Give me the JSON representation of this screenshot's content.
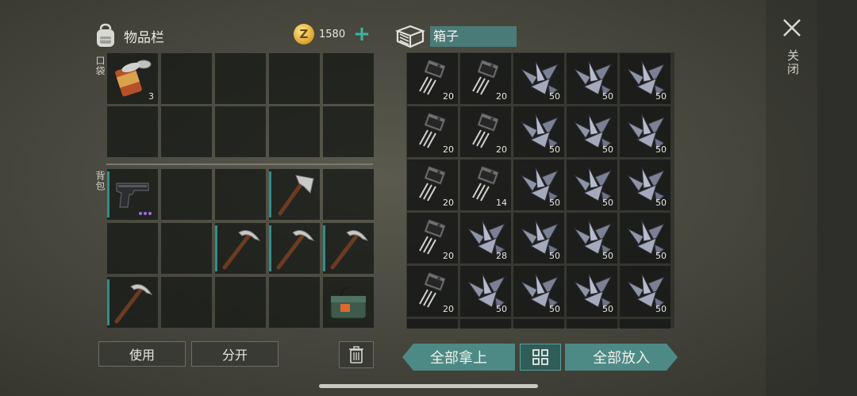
{
  "inventory": {
    "title": "物品栏",
    "coins": "1580",
    "coin_symbol": "Z",
    "add_label": "+",
    "pocket_label": "口袋",
    "backpack_label": "背包",
    "slots": [
      {
        "item": "can-icon",
        "count": "3"
      },
      {
        "item": "pistol-icon",
        "count": "",
        "rarity_dots": 3
      },
      {
        "item": "hatchet-icon",
        "count": ""
      },
      {
        "item": "pickaxe-icon",
        "count": ""
      },
      {
        "item": "pickaxe-icon",
        "count": ""
      },
      {
        "item": "pickaxe-icon",
        "count": ""
      },
      {
        "item": "pickaxe-icon",
        "count": ""
      },
      {
        "item": "ammo-box-icon",
        "count": ""
      }
    ]
  },
  "container": {
    "name": "箱子",
    "rows": [
      [
        {
          "item": "transistor-icon",
          "count": "20"
        },
        {
          "item": "transistor-icon",
          "count": "20"
        },
        {
          "item": "metal-scrap-icon",
          "count": "50"
        },
        {
          "item": "metal-scrap-icon",
          "count": "50"
        },
        {
          "item": "metal-scrap-icon",
          "count": "50"
        }
      ],
      [
        {
          "item": "transistor-icon",
          "count": "20"
        },
        {
          "item": "transistor-icon",
          "count": "20"
        },
        {
          "item": "metal-scrap-icon",
          "count": "50"
        },
        {
          "item": "metal-scrap-icon",
          "count": "50"
        },
        {
          "item": "metal-scrap-icon",
          "count": "50"
        }
      ],
      [
        {
          "item": "transistor-icon",
          "count": "20"
        },
        {
          "item": "transistor-icon",
          "count": "14"
        },
        {
          "item": "metal-scrap-icon",
          "count": "50"
        },
        {
          "item": "metal-scrap-icon",
          "count": "50"
        },
        {
          "item": "metal-scrap-icon",
          "count": "50"
        }
      ],
      [
        {
          "item": "transistor-icon",
          "count": "20"
        },
        {
          "item": "metal-scrap-icon",
          "count": "28"
        },
        {
          "item": "metal-scrap-icon",
          "count": "50"
        },
        {
          "item": "metal-scrap-icon",
          "count": "50"
        },
        {
          "item": "metal-scrap-icon",
          "count": "50"
        }
      ],
      [
        {
          "item": "transistor-icon",
          "count": "20"
        },
        {
          "item": "metal-scrap-icon",
          "count": "50"
        },
        {
          "item": "metal-scrap-icon",
          "count": "50"
        },
        {
          "item": "metal-scrap-icon",
          "count": "50"
        },
        {
          "item": "metal-scrap-icon",
          "count": "50"
        }
      ]
    ]
  },
  "actions": {
    "use": "使用",
    "split": "分开",
    "take_all": "全部拿上",
    "put_all": "全部放入"
  },
  "close": {
    "label": "关闭"
  },
  "colors": {
    "accent_teal": "#4d8a86",
    "coin_gold": "#d8a12b",
    "rarity_purple": "#a56be0"
  }
}
